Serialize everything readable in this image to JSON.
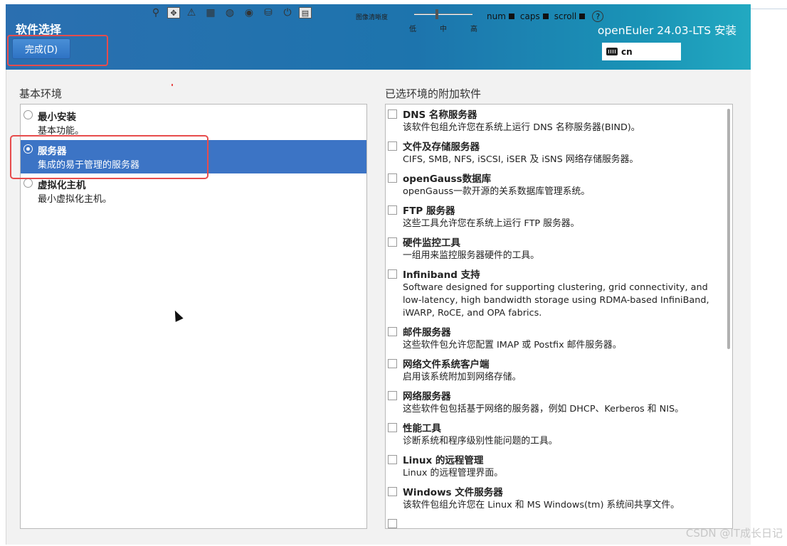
{
  "header": {
    "title": "软件选择",
    "done_button": "完成(D)",
    "product": "openEuler 24.03-LTS 安装",
    "keyboard_layout": "cn"
  },
  "toolbar": {
    "icons": [
      "pin-icon",
      "move-icon",
      "warning-icon",
      "film-icon",
      "mouse-icon",
      "cd-icon",
      "disk-icon",
      "power-icon",
      "grid-icon"
    ],
    "clarity_label": "图像清晰度",
    "slider_low": "低",
    "slider_mid": "中",
    "slider_high": "高",
    "num": "num",
    "caps": "caps",
    "scroll": "scroll"
  },
  "environment": {
    "label": "基本环境",
    "items": [
      {
        "name": "最小安装",
        "desc": "基本功能。",
        "selected": false
      },
      {
        "name": "服务器",
        "desc": "集成的易于管理的服务器",
        "selected": true
      },
      {
        "name": "虚拟化主机",
        "desc": "最小虚拟化主机。",
        "selected": false
      }
    ]
  },
  "addons": {
    "label": "已选环境的附加软件",
    "items": [
      {
        "name": "DNS 名称服务器",
        "desc": "该软件包组允许您在系统上运行 DNS 名称服务器(BIND)。"
      },
      {
        "name": "文件及存储服务器",
        "desc": "CIFS, SMB, NFS, iSCSI, iSER 及 iSNS 网络存储服务器。"
      },
      {
        "name": "openGauss数据库",
        "desc": "openGauss一款开源的关系数据库管理系统。"
      },
      {
        "name": "FTP 服务器",
        "desc": "这些工具允许您在系统上运行 FTP 服务器。"
      },
      {
        "name": "硬件监控工具",
        "desc": "一组用来监控服务器硬件的工具。"
      },
      {
        "name": "Infiniband 支持",
        "desc": "Software designed for supporting clustering, grid connectivity, and low-latency, high bandwidth storage using RDMA-based InfiniBand, iWARP, RoCE, and OPA fabrics."
      },
      {
        "name": "邮件服务器",
        "desc": "这些软件包允许您配置 IMAP 或 Postfix 邮件服务器。"
      },
      {
        "name": "网络文件系统客户端",
        "desc": "启用该系统附加到网络存储。"
      },
      {
        "name": "网络服务器",
        "desc": "这些软件包包括基于网络的服务器，例如 DHCP、Kerberos 和 NIS。"
      },
      {
        "name": "性能工具",
        "desc": "诊断系统和程序级别性能问题的工具。"
      },
      {
        "name": "Linux 的远程管理",
        "desc": "Linux 的远程管理界面。"
      },
      {
        "name": "Windows 文件服务器",
        "desc": "该软件包组允许您在 Linux 和 MS Windows(tm) 系统间共享文件。"
      }
    ]
  },
  "watermark": "CSDN @IT成长日记"
}
